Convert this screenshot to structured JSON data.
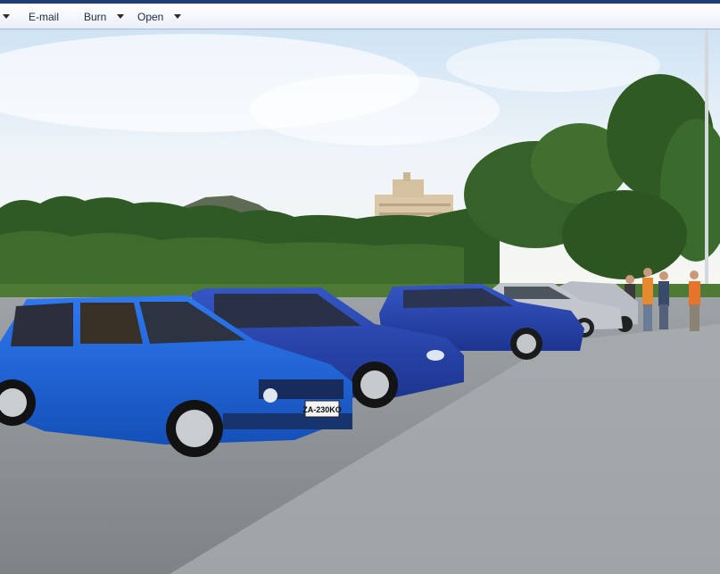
{
  "toolbar": {
    "email_label": "E-mail",
    "burn_label": "Burn",
    "open_label": "Open"
  },
  "photo": {
    "plate_text": "ZA-230KO"
  },
  "colors": {
    "toolbar_accent": "#1f3f73",
    "car_blue": "#1e63d8",
    "car_silver": "#b9bec6"
  }
}
